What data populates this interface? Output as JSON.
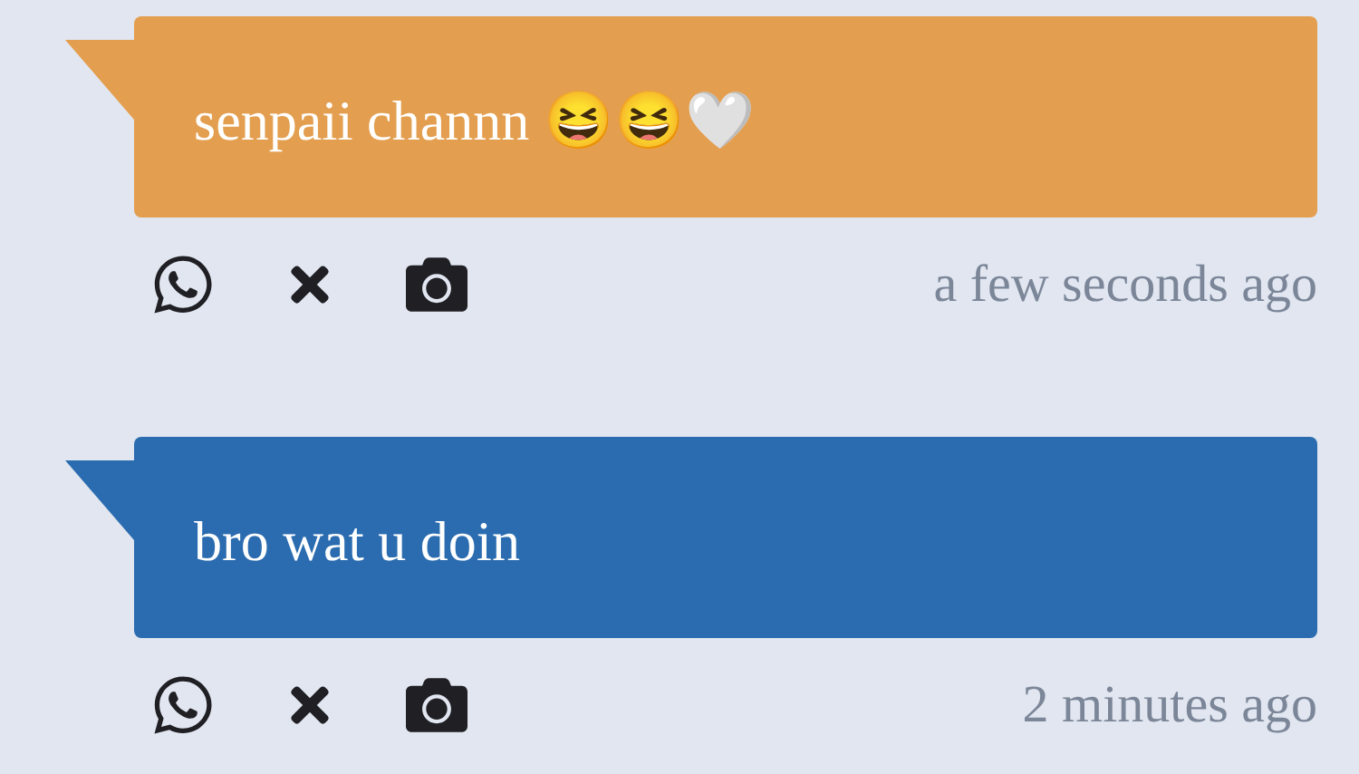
{
  "messages": [
    {
      "text": "senpaii channn 😆😆🤍",
      "color": "#e39f4f",
      "time": "a few seconds ago"
    },
    {
      "text": "bro wat u doin",
      "color": "#2b6cb0",
      "time": "2 minutes ago"
    }
  ]
}
